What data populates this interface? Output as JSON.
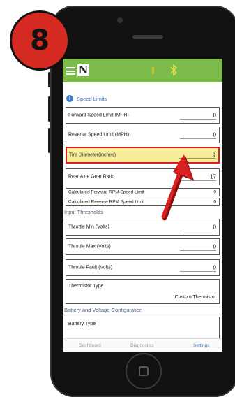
{
  "step_badge": "8",
  "app": {
    "logo_letter": "N"
  },
  "sections": {
    "speed_limits": "Speed Limits",
    "input_thresholds": "Input Thresholds",
    "battery_config": "Battery and Voltage Configuration"
  },
  "fields": {
    "forward_speed": {
      "label": "Forward Speed Limit (MPH)",
      "value": "0"
    },
    "reverse_speed": {
      "label": "Reverse Speed Limit (MPH)",
      "value": "0"
    },
    "tire_diameter": {
      "label": "Tire Diameter(inches)",
      "value": "9"
    },
    "rear_axle": {
      "label": "Rear Axle Gear Ratio",
      "value": "17"
    },
    "calc_forward_rpm": {
      "label": "Calculated Forward RPM Speed Limit",
      "value": "0"
    },
    "calc_reverse_rpm": {
      "label": "Calculated Reverse RPM Speed Limit",
      "value": "0"
    },
    "throttle_min": {
      "label": "Throttle Min (Volts)",
      "value": "0"
    },
    "throttle_max": {
      "label": "Throttle Max (Volts)",
      "value": "0"
    },
    "throttle_fault": {
      "label": "Throttle Fault (Volts)",
      "value": "0"
    },
    "thermistor_type": {
      "label": "Thermistor Type",
      "value": "Custom Thermistor"
    },
    "battery_type": {
      "label": "Battery Type",
      "value": ""
    }
  },
  "nav": {
    "dashboard": "Dashboard",
    "diagnostics": "Diagnostics",
    "settings": "Settings"
  },
  "colors": {
    "appbar": "#7dbb4a",
    "highlight_fill": "#f7ee9a",
    "highlight_border": "#d91f1f",
    "arrow": "#d91f1f",
    "badge": "#d42a22"
  }
}
